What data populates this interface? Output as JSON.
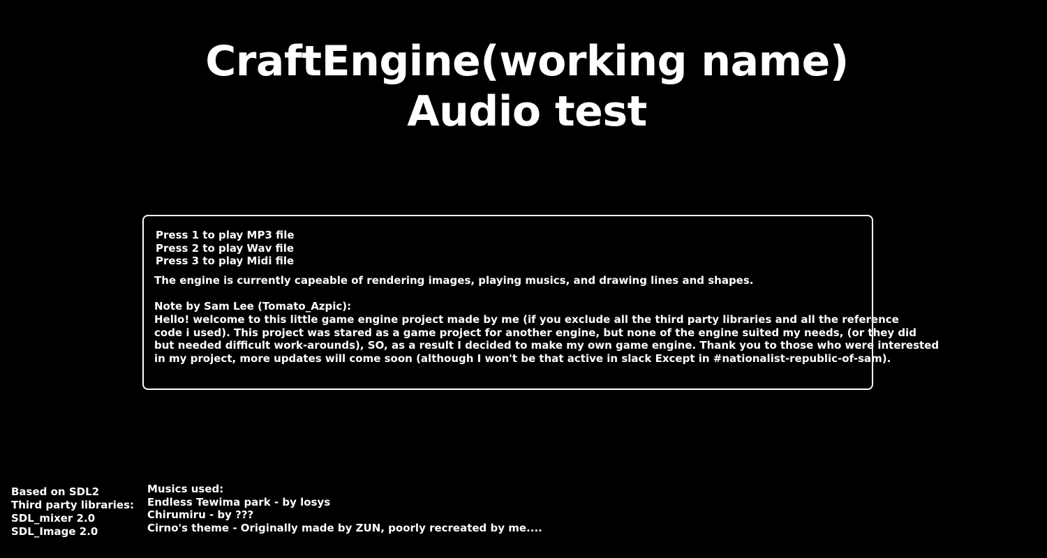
{
  "title": {
    "line1": "CraftEngine(working name)",
    "line2": "Audio test"
  },
  "info_box": {
    "controls": [
      "Press 1 to play MP3 file",
      "Press 2 to play Wav file",
      "Press 3 to play Midi file"
    ],
    "capability": "The engine is currently capeable of rendering images, playing musics, and drawing lines and shapes.",
    "note_heading": "Note by Sam Lee (Tomato_Azpic):",
    "note_lines": [
      "Hello! welcome to this little game engine project made by me (if you exclude all the third party libraries and all the reference",
      "code i used). This project was stared as a game project for another engine, but none of the engine suited my needs, (or they did",
      "but needed difficult work-arounds), SO, as a result I decided to make my own game engine. Thank you to those who were interested",
      "in my project, more updates will come soon (although I won't be that active in slack Except in #nationalist-republic-of-sam)."
    ]
  },
  "credits": {
    "libraries": [
      "Based on SDL2",
      "Third party libraries:",
      "SDL_mixer 2.0",
      "SDL_Image 2.0"
    ],
    "music_heading": "Musics used:",
    "musics": [
      "Endless Tewima park - by losys",
      "Chirumiru - by ???",
      "Cirno's theme - Originally made by ZUN, poorly recreated by me...."
    ]
  },
  "colors": {
    "background": "#000000",
    "text": "#ffffff",
    "border": "#ffffff"
  }
}
